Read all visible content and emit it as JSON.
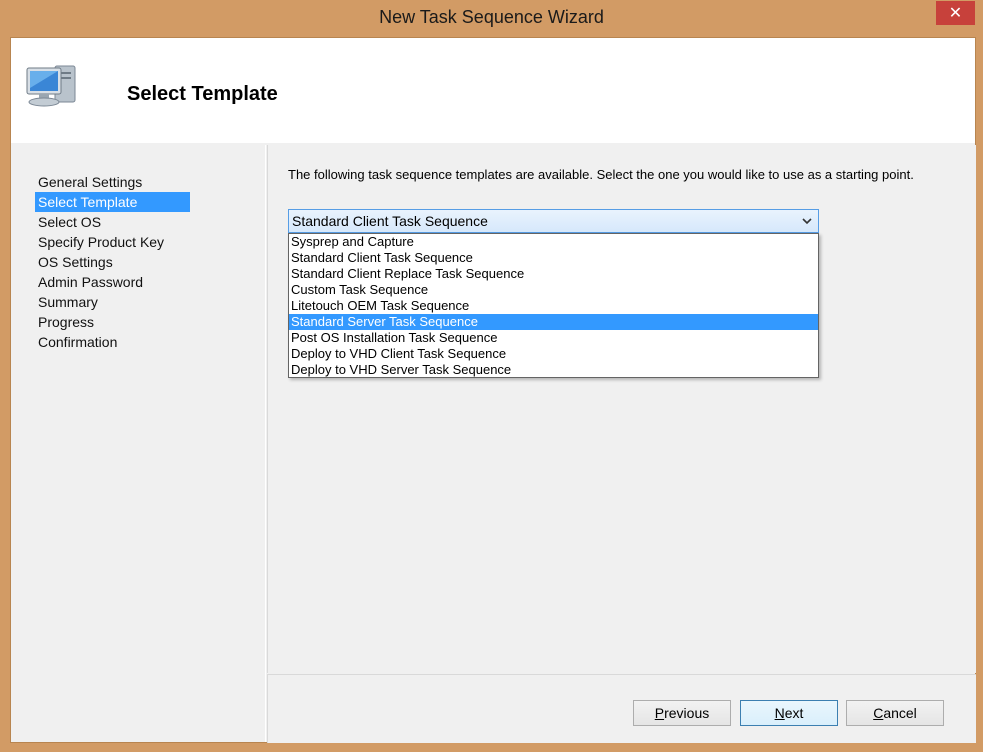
{
  "window": {
    "title": "New Task Sequence Wizard",
    "close_glyph": "✕"
  },
  "header": {
    "title": "Select Template",
    "icon": "computer-icon"
  },
  "sidebar": {
    "items": [
      {
        "label": "General Settings",
        "selected": false
      },
      {
        "label": "Select Template",
        "selected": true
      },
      {
        "label": "Select OS",
        "selected": false
      },
      {
        "label": "Specify Product Key",
        "selected": false
      },
      {
        "label": "OS Settings",
        "selected": false
      },
      {
        "label": "Admin Password",
        "selected": false
      },
      {
        "label": "Summary",
        "selected": false
      },
      {
        "label": "Progress",
        "selected": false
      },
      {
        "label": "Confirmation",
        "selected": false
      }
    ]
  },
  "main": {
    "instruction": "The following task sequence templates are available.  Select the one you would like to use as a starting point.",
    "combo": {
      "value": "Standard Client Task Sequence",
      "options": [
        {
          "label": "Sysprep and Capture",
          "highlighted": false
        },
        {
          "label": "Standard Client Task Sequence",
          "highlighted": false
        },
        {
          "label": "Standard Client Replace Task Sequence",
          "highlighted": false
        },
        {
          "label": "Custom Task Sequence",
          "highlighted": false
        },
        {
          "label": "Litetouch OEM Task Sequence",
          "highlighted": false
        },
        {
          "label": "Standard Server Task Sequence",
          "highlighted": true
        },
        {
          "label": "Post OS Installation Task Sequence",
          "highlighted": false
        },
        {
          "label": "Deploy to VHD Client Task Sequence",
          "highlighted": false
        },
        {
          "label": "Deploy to VHD Server Task Sequence",
          "highlighted": false
        }
      ]
    }
  },
  "footer": {
    "previous": {
      "accel": "P",
      "rest": "revious"
    },
    "next": {
      "accel": "N",
      "rest": "ext"
    },
    "cancel": {
      "accel": "C",
      "rest": "ancel"
    }
  },
  "colors": {
    "frame": "#d29b65",
    "selection": "#3399ff",
    "close_button": "#c7413b"
  }
}
